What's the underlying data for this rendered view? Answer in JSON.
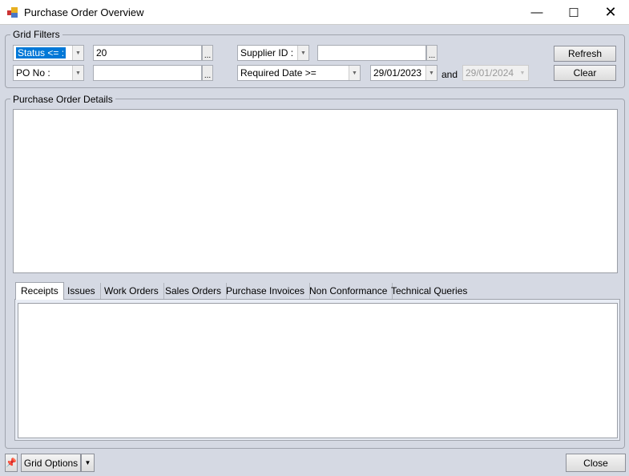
{
  "window": {
    "title": "Purchase Order Overview",
    "controls": [
      "minimize",
      "maximize",
      "close"
    ]
  },
  "grid_filters": {
    "label": "Grid Filters",
    "filter1": {
      "field": "Status <= :",
      "value": "20"
    },
    "filter2": {
      "field": "PO No :",
      "value": ""
    },
    "filter3": {
      "field": "Supplier ID :",
      "value": ""
    },
    "filter4": {
      "field": "Required Date >=",
      "date_from": "29/01/2023",
      "and_label": "and",
      "date_to": "29/01/2024"
    },
    "ellipsis": "...",
    "refresh": "Refresh",
    "clear": "Clear"
  },
  "details": {
    "label": "Purchase Order Details"
  },
  "tabs": [
    "Receipts",
    "Issues",
    "Work Orders",
    "Sales Orders",
    "Purchase Invoices",
    "Non Conformance",
    "Technical Queries"
  ],
  "footer": {
    "grid_options": "Grid Options",
    "close": "Close"
  }
}
